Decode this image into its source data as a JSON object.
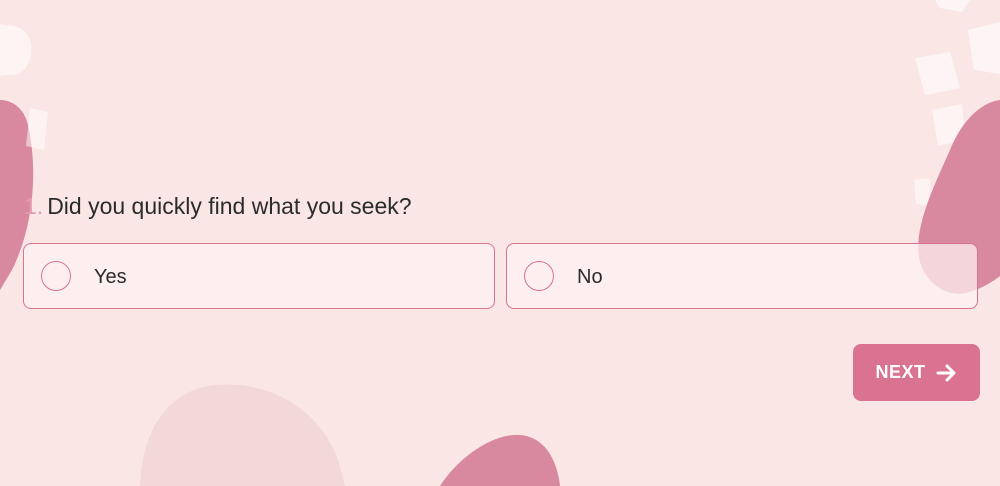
{
  "question": {
    "number": "1.",
    "text": "Did you quickly find what you seek?"
  },
  "options": [
    {
      "label": "Yes",
      "selected": false
    },
    {
      "label": "No",
      "selected": false
    }
  ],
  "next_button": {
    "label": "NEXT",
    "icon": "arrow-right-icon"
  },
  "colors": {
    "background": "#fae6e5",
    "accent": "#d9738f",
    "question_number": "#e29bb0",
    "text": "#2b2b2b"
  }
}
